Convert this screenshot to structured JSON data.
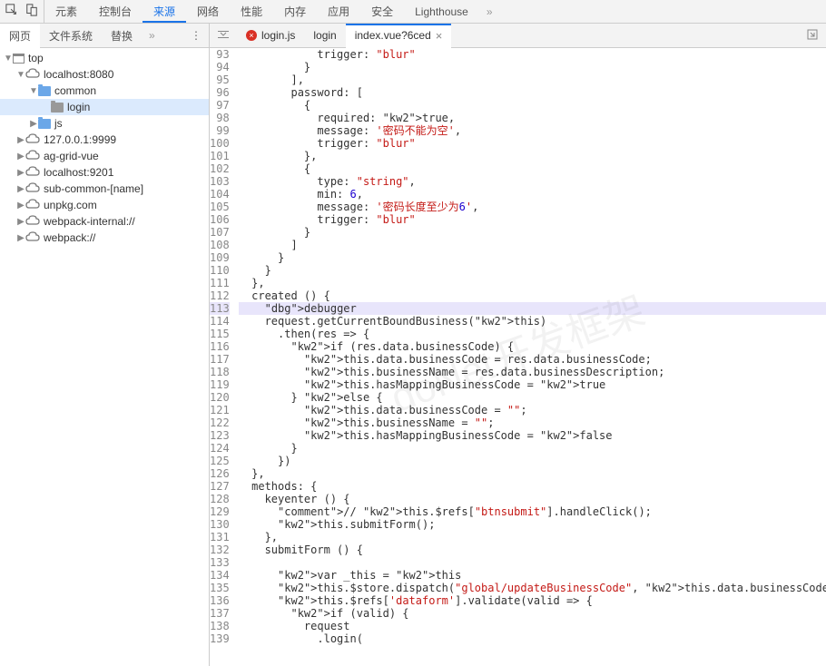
{
  "mainTabs": [
    "元素",
    "控制台",
    "来源",
    "网络",
    "性能",
    "内存",
    "应用",
    "安全",
    "Lighthouse"
  ],
  "mainActive": 2,
  "subTabs": [
    "网页",
    "文件系统",
    "替换"
  ],
  "subActive": 0,
  "fileTabs": [
    {
      "label": "login.js",
      "error": true,
      "active": false
    },
    {
      "label": "login",
      "error": false,
      "active": false
    },
    {
      "label": "index.vue?6ced",
      "error": false,
      "active": true,
      "close": true
    }
  ],
  "tree": {
    "top": "top",
    "nodes": [
      {
        "label": "localhost:8080",
        "type": "cloud",
        "depth": 1,
        "exp": true
      },
      {
        "label": "common",
        "type": "folder",
        "depth": 2,
        "exp": true
      },
      {
        "label": "login",
        "type": "file",
        "depth": 3,
        "selected": true
      },
      {
        "label": "js",
        "type": "folder",
        "depth": 2,
        "exp": false
      },
      {
        "label": "127.0.0.1:9999",
        "type": "cloud",
        "depth": 1,
        "exp": false
      },
      {
        "label": "ag-grid-vue",
        "type": "cloud",
        "depth": 1,
        "exp": false
      },
      {
        "label": "localhost:9201",
        "type": "cloud",
        "depth": 1,
        "exp": false
      },
      {
        "label": "sub-common-[name]",
        "type": "cloud",
        "depth": 1,
        "exp": false
      },
      {
        "label": "unpkg.com",
        "type": "cloud",
        "depth": 1,
        "exp": false
      },
      {
        "label": "webpack-internal://",
        "type": "cloud",
        "depth": 1,
        "exp": false
      },
      {
        "label": "webpack://",
        "type": "cloud",
        "depth": 1,
        "exp": false
      }
    ]
  },
  "code": {
    "startLine": 93,
    "debugLine": 113,
    "lines": [
      "            trigger: \"blur\"",
      "          }",
      "        ],",
      "        password: [",
      "          {",
      "            required: true,",
      "            message: '密码不能为空',",
      "            trigger: \"blur\"",
      "          },",
      "          {",
      "            type: \"string\",",
      "            min: 6,",
      "            message: '密码长度至少为6',",
      "            trigger: \"blur\"",
      "          }",
      "        ]",
      "      }",
      "    }",
      "  },",
      "  created () {",
      "    debugger",
      "    request.getCurrentBoundBusiness(this)",
      "      .then(res => {",
      "        if (res.data.businessCode) {",
      "          this.data.businessCode = res.data.businessCode;",
      "          this.businessName = res.data.businessDescription;",
      "          this.hasMappingBusinessCode = true",
      "        } else {",
      "          this.data.businessCode = \"\";",
      "          this.businessName = \"\";",
      "          this.hasMappingBusinessCode = false",
      "        }",
      "      })",
      "  },",
      "  methods: {",
      "    keyenter () {",
      "      // this.$refs[\"btnsubmit\"].handleClick();",
      "      this.submitForm();",
      "    },",
      "    submitForm () {",
      "",
      "      var _this = this",
      "      this.$store.dispatch(\"global/updateBusinessCode\", this.data.businessCode);",
      "      this.$refs['dataform'].validate(valid => {",
      "        if (valid) {",
      "          request",
      "            .login("
    ]
  },
  "watermark": "doNet开发框架"
}
